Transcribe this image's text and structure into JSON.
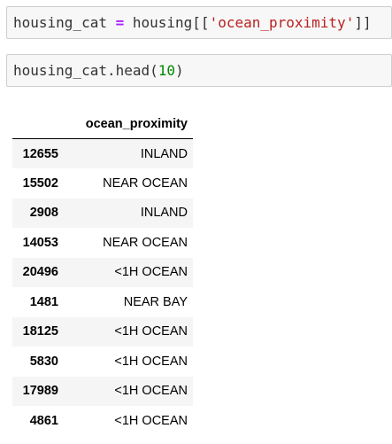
{
  "cells": [
    {
      "tokens": [
        {
          "text": "housing_cat ",
          "kind": "plain"
        },
        {
          "text": "=",
          "kind": "op"
        },
        {
          "text": " housing[[",
          "kind": "plain"
        },
        {
          "text": "'ocean_proximity'",
          "kind": "str"
        },
        {
          "text": "]]",
          "kind": "plain"
        }
      ]
    },
    {
      "tokens": [
        {
          "text": "housing_cat.head(",
          "kind": "plain"
        },
        {
          "text": "10",
          "kind": "num"
        },
        {
          "text": ")",
          "kind": "plain"
        }
      ]
    }
  ],
  "output_table": {
    "index_header": "",
    "column_header": "ocean_proximity",
    "rows": [
      {
        "index": "12655",
        "value": "INLAND"
      },
      {
        "index": "15502",
        "value": "NEAR OCEAN"
      },
      {
        "index": "2908",
        "value": "INLAND"
      },
      {
        "index": "14053",
        "value": "NEAR OCEAN"
      },
      {
        "index": "20496",
        "value": "<1H OCEAN"
      },
      {
        "index": "1481",
        "value": "NEAR BAY"
      },
      {
        "index": "18125",
        "value": "<1H OCEAN"
      },
      {
        "index": "5830",
        "value": "<1H OCEAN"
      },
      {
        "index": "17989",
        "value": "<1H OCEAN"
      },
      {
        "index": "4861",
        "value": "<1H OCEAN"
      }
    ]
  },
  "colors": {
    "cell_background": "#f7f7f7",
    "cell_border": "#cfcfcf",
    "operator": "#aa22ff",
    "string": "#ba2121",
    "number": "#008800",
    "row_stripe": "#f5f5f5"
  }
}
